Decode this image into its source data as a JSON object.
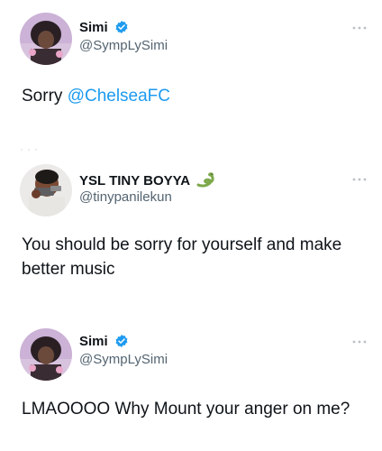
{
  "tweets": [
    {
      "name": "Simi",
      "handle": "@SympLySimi",
      "verified": true,
      "text_prefix": "Sorry ",
      "mention": "@ChelseaFC",
      "text": ""
    },
    {
      "name": "YSL TINY BOYYA",
      "name_emoji": "snake-emoji",
      "handle": "@tinypanilekun",
      "verified": false,
      "text": "You should be sorry for yourself and make better music"
    },
    {
      "name": "Simi",
      "handle": "@SympLySimi",
      "verified": true,
      "text": "LMAOOOO Why Mount your anger on me?"
    }
  ],
  "colors": {
    "verified_badge": "#1d9bf0",
    "mention": "#1d9bf0",
    "handle": "#536471",
    "more_dots": "#b9c0c6"
  },
  "icons": [
    "verified-badge-icon",
    "more-options-icon",
    "snake-emoji-icon"
  ]
}
